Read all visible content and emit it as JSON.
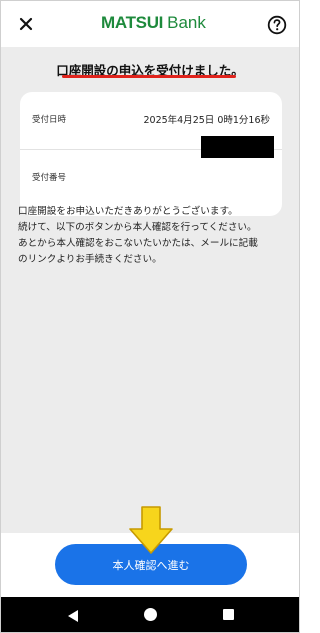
{
  "header": {
    "logo_brand": "MATSUI",
    "logo_suffix": "Bank",
    "close_icon": "close-icon",
    "help_icon": "help-circle-icon"
  },
  "main": {
    "title": "口座開設の申込を受付けました。",
    "receipt": {
      "date_label": "受付日時",
      "date_value": "2025年4月25日 0時1分16秒",
      "number_label": "受付番号",
      "number_value_redacted": true
    },
    "message_lines": [
      "口座開設をお申込いただきありがとうございます。",
      "続けて、以下のボタンから本人確認を行ってください。",
      "あとから本人確認をおこないたいかたは、メールに記載",
      "のリンクよりお手続きください。"
    ]
  },
  "footer": {
    "proceed_label": "本人確認へ進む"
  },
  "colors": {
    "brand_green": "#1e8a3c",
    "underline_red": "#e0231c",
    "button_blue": "#1a73e8",
    "arrow_yellow": "#f7d51c",
    "background_gray": "#ececec"
  },
  "navbar": {
    "icons": [
      "back-icon",
      "home-icon",
      "recents-icon"
    ]
  }
}
